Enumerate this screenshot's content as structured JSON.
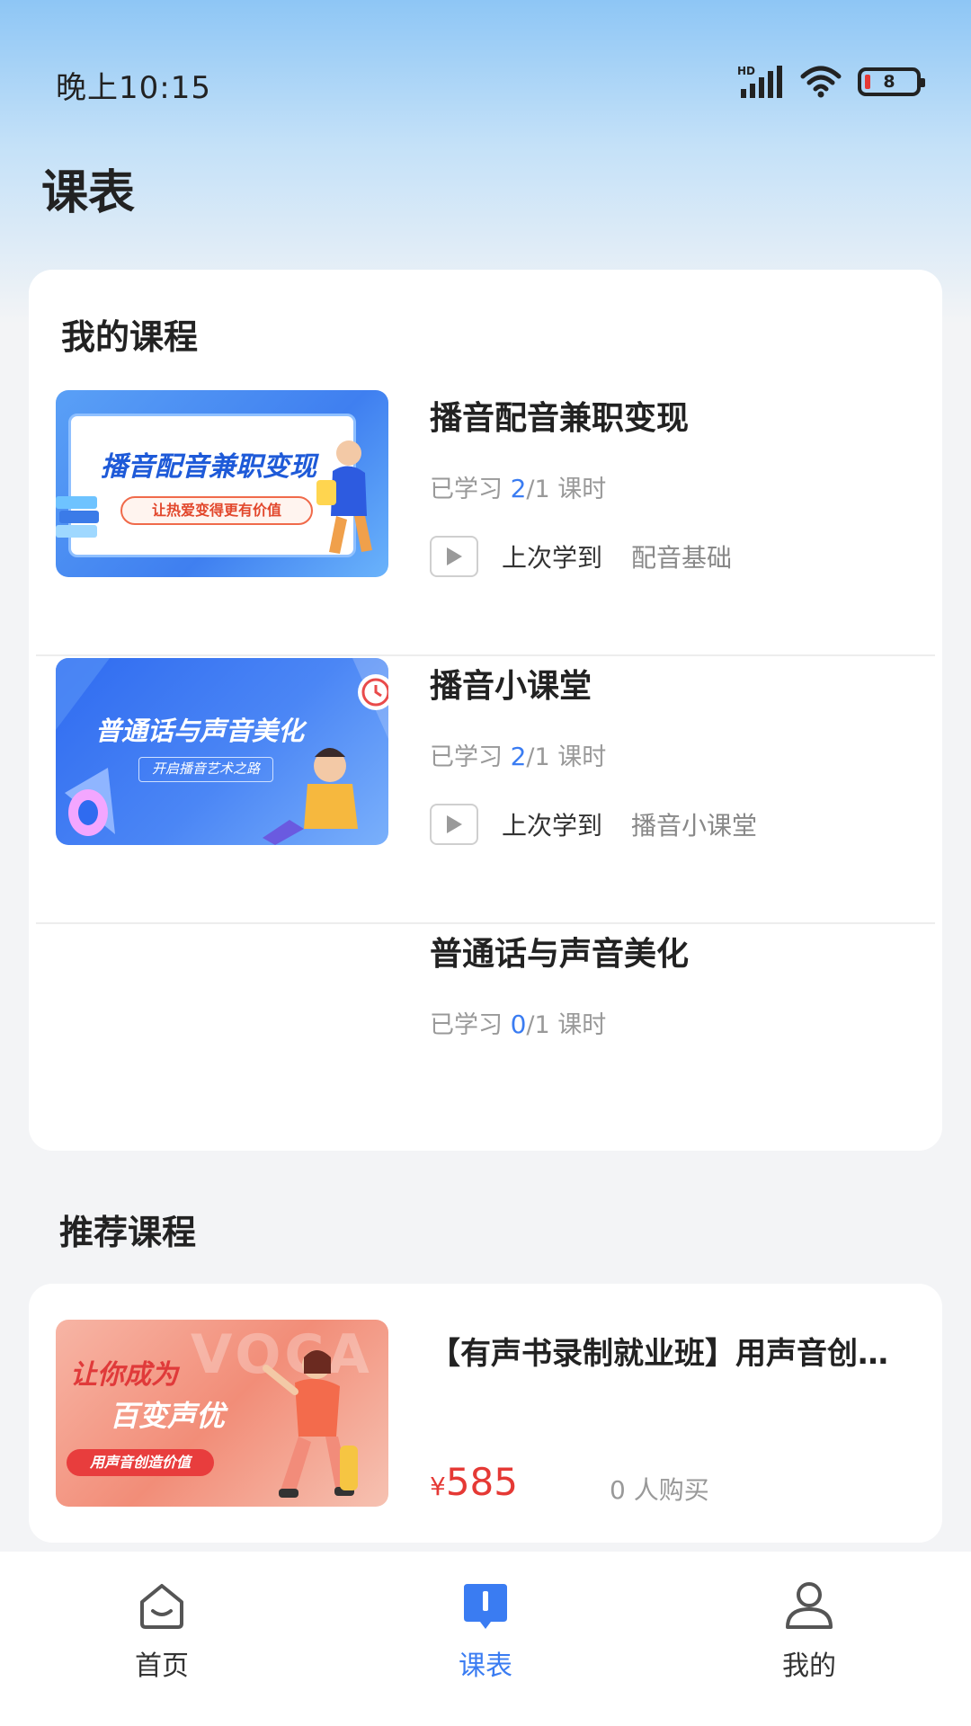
{
  "status_bar": {
    "time": "晚上10:15",
    "network": "HD",
    "battery": "8"
  },
  "page": {
    "title": "课表"
  },
  "my_courses": {
    "heading": "我的课程",
    "items": [
      {
        "title": "播音配音兼职变现",
        "progress_prefix": "已学习",
        "done": "2",
        "total": "/1 课时",
        "last_label": "上次学到",
        "last_value": "配音基础",
        "thumb": {
          "title": "播音配音兼职变现",
          "subtitle": "让热爱变得更有价值"
        }
      },
      {
        "title": "播音小课堂",
        "progress_prefix": "已学习",
        "done": "2",
        "total": "/1 课时",
        "last_label": "上次学到",
        "last_value": "播音小课堂",
        "thumb": {
          "title": "普通话与声音美化",
          "subtitle": "开启播音艺术之路"
        }
      },
      {
        "title": "普通话与声音美化",
        "progress_prefix": "已学习",
        "done": "0",
        "total": "/1 课时"
      }
    ]
  },
  "recommended": {
    "heading": "推荐课程",
    "items": [
      {
        "title": "【有声书录制就业班】用声音创造价值",
        "currency": "¥",
        "price": "585",
        "buyers": "0 人购买",
        "thumb": {
          "line1": "让你成为",
          "line2": "百变声优",
          "tag": "用声音创造价值",
          "watermark": "VOCA"
        }
      }
    ]
  },
  "bottom_nav": {
    "items": [
      {
        "label": "首页",
        "icon": "home-icon",
        "active": false
      },
      {
        "label": "课表",
        "icon": "schedule-icon",
        "active": true
      },
      {
        "label": "我的",
        "icon": "profile-icon",
        "active": false
      }
    ]
  },
  "colors": {
    "accent": "#3a7cf2",
    "price": "#e53935",
    "background": "#f3f4f6"
  }
}
